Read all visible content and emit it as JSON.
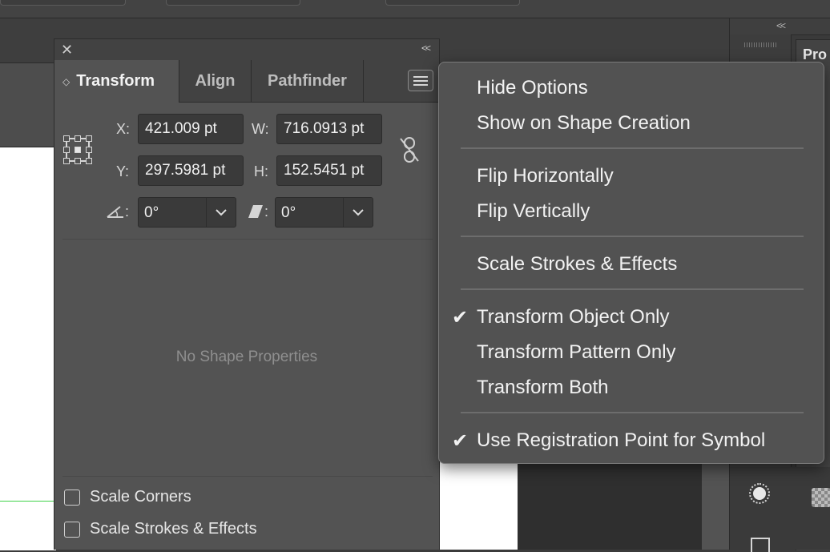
{
  "transform_panel": {
    "tabs": [
      {
        "label": "Transform",
        "active": true
      },
      {
        "label": "Align",
        "active": false
      },
      {
        "label": "Pathfinder",
        "active": false
      }
    ],
    "fields": {
      "x": {
        "label": "X:",
        "value": "421.009 pt"
      },
      "y": {
        "label": "Y:",
        "value": "297.5981 pt"
      },
      "w": {
        "label": "W:",
        "value": "716.0913 pt"
      },
      "h": {
        "label": "H:",
        "value": "152.5451 pt"
      },
      "rotate": {
        "label": ":",
        "value": "0°"
      },
      "shear": {
        "label": ":",
        "value": "0°"
      }
    },
    "no_shape_text": "No Shape Properties",
    "checkboxes": [
      {
        "label": "Scale Corners",
        "checked": false
      },
      {
        "label": "Scale Strokes & Effects",
        "checked": false
      }
    ]
  },
  "flyout_menu": {
    "groups": [
      [
        {
          "label": "Hide Options",
          "checked": false
        },
        {
          "label": "Show on Shape Creation",
          "checked": false
        }
      ],
      [
        {
          "label": "Flip Horizontally",
          "checked": false
        },
        {
          "label": "Flip Vertically",
          "checked": false
        }
      ],
      [
        {
          "label": "Scale Strokes & Effects",
          "checked": false
        }
      ],
      [
        {
          "label": "Transform Object Only",
          "checked": true
        },
        {
          "label": "Transform Pattern Only",
          "checked": false
        },
        {
          "label": "Transform Both",
          "checked": false
        }
      ],
      [
        {
          "label": "Use Registration Point for Symbol",
          "checked": true
        }
      ]
    ],
    "check_glyph": "✔"
  },
  "right_dock": {
    "panel_title": "Pro"
  },
  "colors": {
    "panel_bg": "#535353",
    "field_bg": "#3a3a3a",
    "menu_bg": "#525252",
    "artboard": "#ffffff",
    "guide_green": "#3fd24a"
  }
}
